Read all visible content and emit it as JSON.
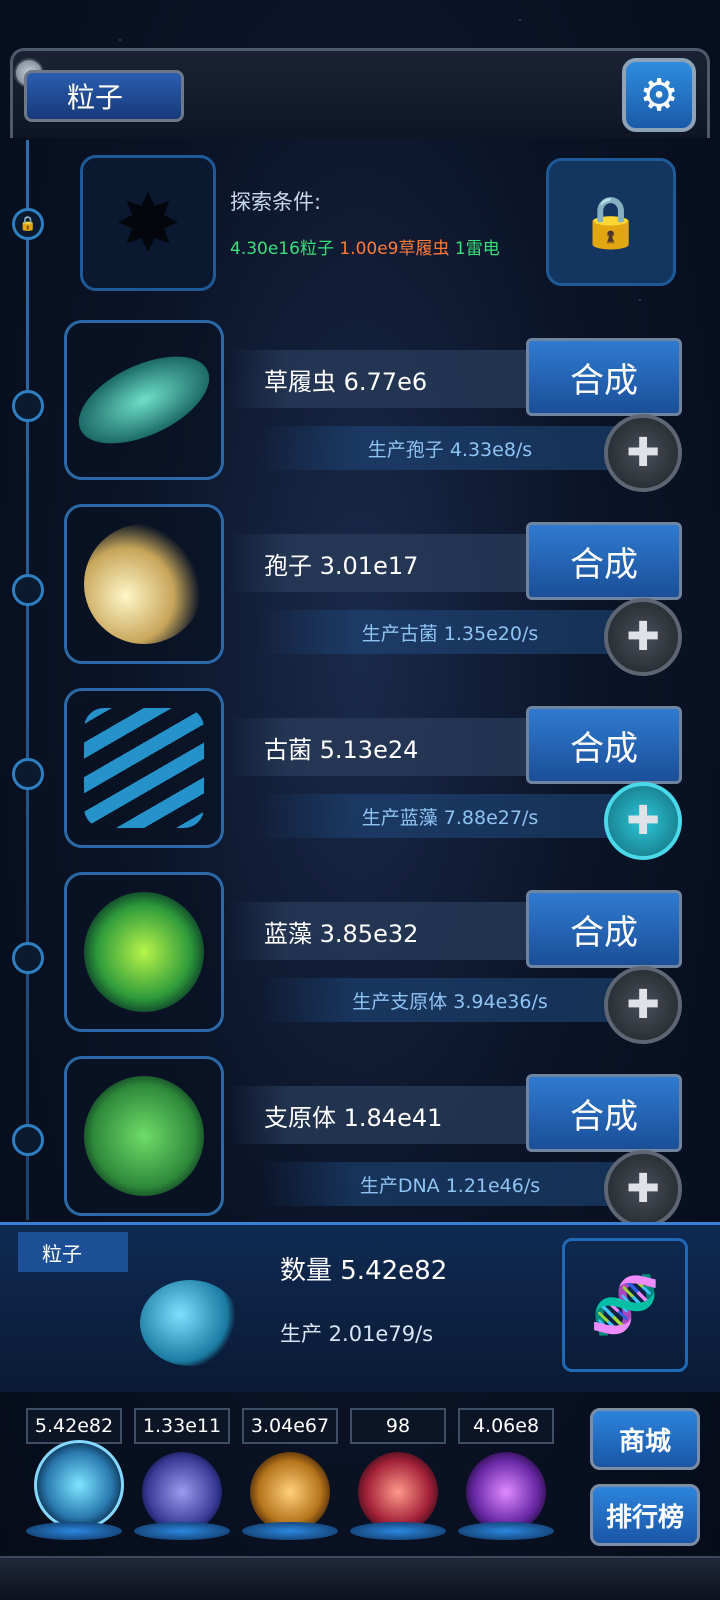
{
  "header": {
    "title": "粒子",
    "settings_icon": "gear-icon"
  },
  "explore": {
    "label": "探索条件:",
    "conditions": [
      {
        "text": "4.30e16粒子",
        "color": "#39e07a"
      },
      {
        "text": "1.00e9草履虫",
        "color": "#ff7b3a"
      },
      {
        "text": "1雷电",
        "color": "#39e07a"
      }
    ]
  },
  "creatures": [
    {
      "name": "草履虫 6.77e6",
      "production": "生产孢子 4.33e8/s",
      "synth": "合成",
      "plus_active": false
    },
    {
      "name": "孢子 3.01e17",
      "production": "生产古菌 1.35e20/s",
      "synth": "合成",
      "plus_active": false
    },
    {
      "name": "古菌 5.13e24",
      "production": "生产蓝藻 7.88e27/s",
      "synth": "合成",
      "plus_active": true
    },
    {
      "name": "蓝藻 3.85e32",
      "production": "生产支原体 3.94e36/s",
      "synth": "合成",
      "plus_active": false
    },
    {
      "name": "支原体 1.84e41",
      "production": "生产DNA 1.21e46/s",
      "synth": "合成",
      "plus_active": false
    }
  ],
  "panel": {
    "tab": "粒子",
    "count": "数量 5.42e82",
    "production": "生产 2.01e79/s"
  },
  "resources": [
    "5.42e82",
    "1.33e11",
    "3.04e67",
    "98",
    "4.06e8"
  ],
  "side_buttons": {
    "shop": "商城",
    "rank": "排行榜"
  }
}
